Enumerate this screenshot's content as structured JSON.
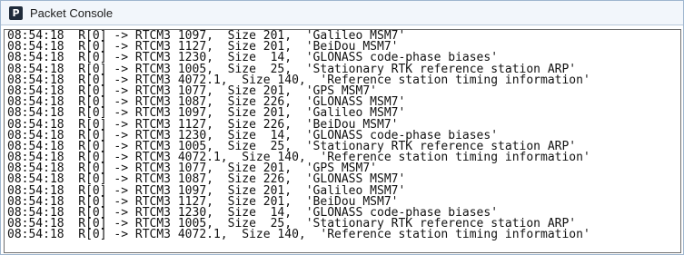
{
  "window": {
    "title": "Packet Console",
    "icon": "p-app-icon"
  },
  "console": {
    "lines": [
      "08:54:18  R[0] -> RTCM3 1097,  Size 201,  'Galileo MSM7'",
      "08:54:18  R[0] -> RTCM3 1127,  Size 201,  'BeiDou MSM7'",
      "08:54:18  R[0] -> RTCM3 1230,  Size  14,  'GLONASS code-phase biases'",
      "08:54:18  R[0] -> RTCM3 1005,  Size  25,  'Stationary RTK reference station ARP'",
      "08:54:18  R[0] -> RTCM3 4072.1,  Size 140,  'Reference station timing information'",
      "08:54:18  R[0] -> RTCM3 1077,  Size 201,  'GPS MSM7'",
      "08:54:18  R[0] -> RTCM3 1087,  Size 226,  'GLONASS MSM7'",
      "08:54:18  R[0] -> RTCM3 1097,  Size 201,  'Galileo MSM7'",
      "08:54:18  R[0] -> RTCM3 1127,  Size 226,  'BeiDou MSM7'",
      "08:54:18  R[0] -> RTCM3 1230,  Size  14,  'GLONASS code-phase biases'",
      "08:54:18  R[0] -> RTCM3 1005,  Size  25,  'Stationary RTK reference station ARP'",
      "08:54:18  R[0] -> RTCM3 4072.1,  Size 140,  'Reference station timing information'",
      "08:54:18  R[0] -> RTCM3 1077,  Size 201,  'GPS MSM7'",
      "08:54:18  R[0] -> RTCM3 1087,  Size 226,  'GLONASS MSM7'",
      "08:54:18  R[0] -> RTCM3 1097,  Size 201,  'Galileo MSM7'",
      "08:54:18  R[0] -> RTCM3 1127,  Size 201,  'BeiDou MSM7'",
      "08:54:18  R[0] -> RTCM3 1230,  Size  14,  'GLONASS code-phase biases'",
      "08:54:18  R[0] -> RTCM3 1005,  Size  25,  'Stationary RTK reference station ARP'",
      "08:54:18  R[0] -> RTCM3 4072.1,  Size 140,  'Reference station timing information'"
    ]
  }
}
